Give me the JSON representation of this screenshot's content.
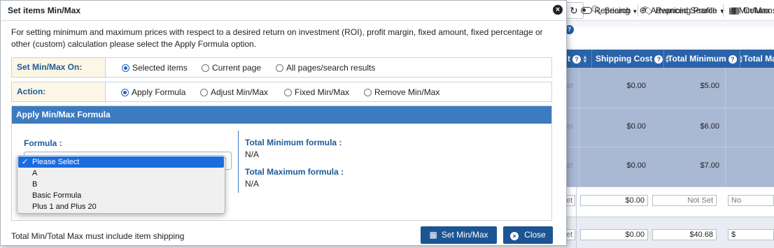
{
  "background_app": {
    "toolbar": {
      "refresh_icon": "refresh-icon",
      "search_label": "Search",
      "advanced_search_label": "Advanced Search",
      "columns_label": "Columns"
    },
    "toolbar2": {
      "repricing_label": "Repricing",
      "repricing_profile_label": "Repricing Profile",
      "minmax_label": "Min/Max"
    },
    "grid": {
      "headers": {
        "cost_partial": "t",
        "shipping_cost": "Shipping Cost",
        "total_minimum": "Total Minimum",
        "total_max_partial": "Total Ma"
      },
      "rows": [
        {
          "faded": "et",
          "shipping": "$0.00",
          "total_min": "$5.00"
        },
        {
          "faded": "et",
          "shipping": "$0.00",
          "total_min": "$6.00"
        },
        {
          "faded": "et",
          "shipping": "$0.00",
          "total_min": "$7.00"
        },
        {
          "faded": "et",
          "shipping": "$0.00",
          "total_min": "Not Set",
          "total_max": "No"
        },
        {
          "faded": "et",
          "shipping": "$0.00",
          "total_min": "$40.68",
          "total_max": "$"
        }
      ]
    }
  },
  "modal": {
    "title": "Set items Min/Max",
    "intro": "For setting minimum and maximum prices with respect to a desired return on investment (ROI), profit margin, fixed amount, fixed percentage or other (custom) calculation please select the Apply Formula option.",
    "set_on": {
      "label": "Set Min/Max On:",
      "options": [
        "Selected items",
        "Current page",
        "All pages/search results"
      ],
      "selected": "Selected items"
    },
    "action": {
      "label": "Action:",
      "options": [
        "Apply Formula",
        "Adjust Min/Max",
        "Fixed Min/Max",
        "Remove Min/Max"
      ],
      "selected": "Apply Formula"
    },
    "formula_section": {
      "heading": "Apply Min/Max Formula",
      "formula_label": "Formula :",
      "dropdown_options": [
        "Please Select",
        "A",
        "B",
        "Basic Formula",
        "Plus 1 and Plus 20"
      ],
      "selected_option": "Please Select",
      "check_mark": "✓",
      "total_min_label": "Total Minimum formula :",
      "total_min_value": "N/A",
      "total_max_label": "Total Maximum formula :",
      "total_max_value": "N/A"
    },
    "footer_note": "Total Min/Total Max must include item shipping",
    "set_button": "Set Min/Max",
    "close_button": "Close"
  }
}
